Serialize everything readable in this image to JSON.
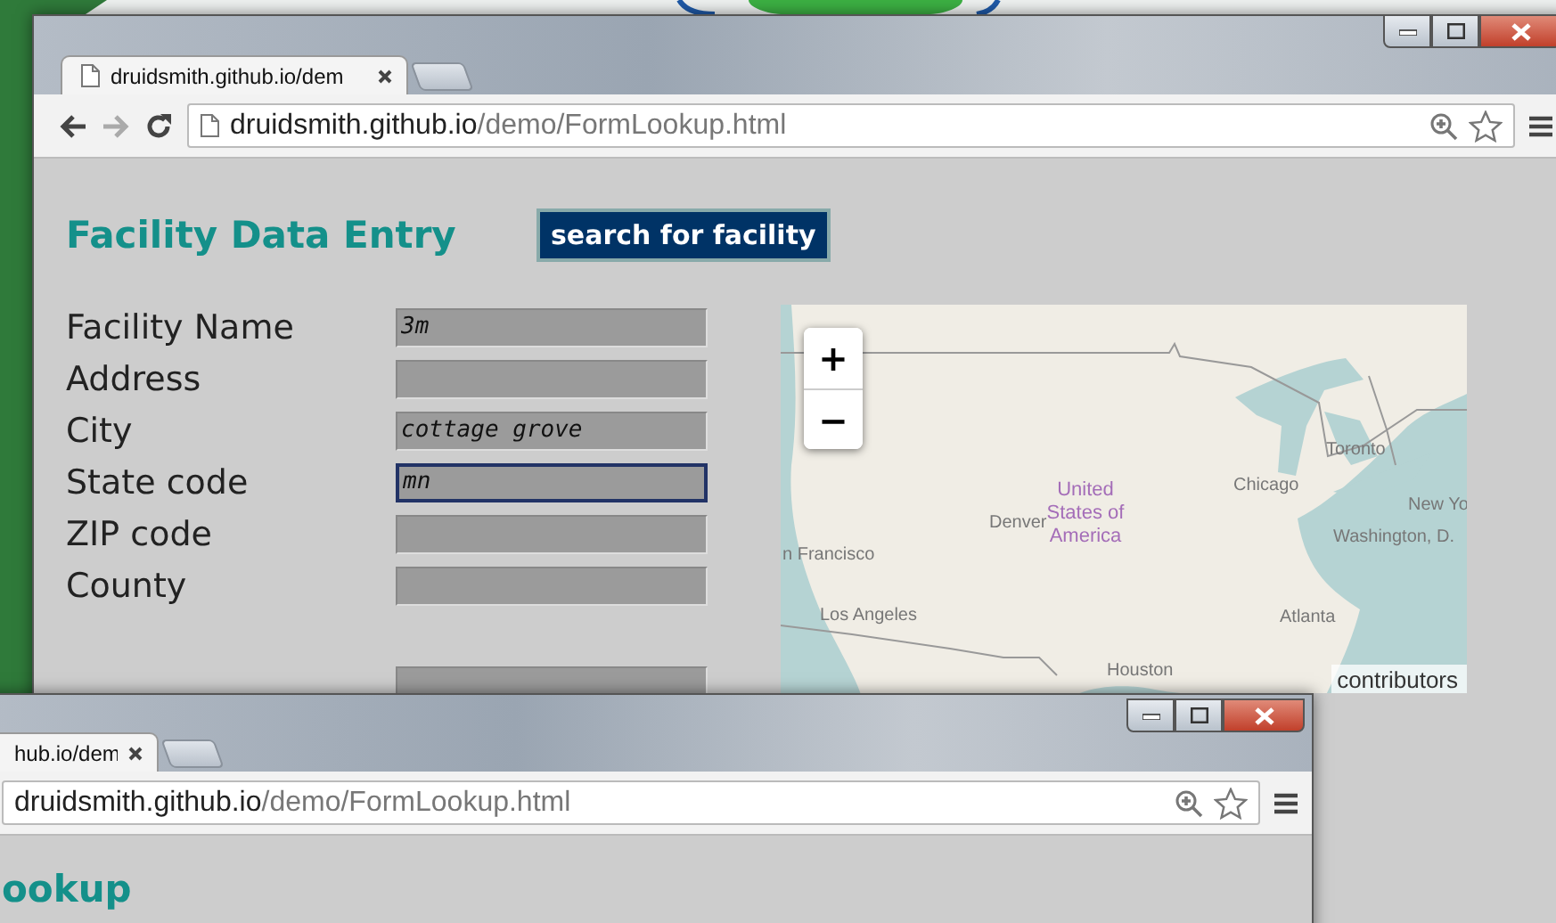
{
  "back_window": {
    "tab_title": "druidsmith.github.io/dem",
    "address": {
      "host": "druidsmith.github.io",
      "path": "/demo/FormLookup.html"
    },
    "heading": "Facility Data Entry",
    "search_button": "search for facility",
    "fields": [
      {
        "label": "Facility Name",
        "value": "3m",
        "focused": false
      },
      {
        "label": "Address",
        "focused": false
      },
      {
        "label": "City",
        "value": "cottage grove",
        "focused": false
      },
      {
        "label": "State code",
        "value": "mn",
        "focused": true
      },
      {
        "label": "ZIP code",
        "focused": false
      },
      {
        "label": "County",
        "focused": false
      }
    ],
    "coordinate_fields": [
      {
        "focused": false
      }
    ],
    "map": {
      "zoom_in": "+",
      "zoom_out": "−",
      "places": [
        {
          "name": "n Francisco",
          "kind": "city"
        },
        {
          "name": "Los Angeles",
          "kind": "city"
        },
        {
          "name": "Denver",
          "kind": "city"
        },
        {
          "name": "United States of America",
          "kind": "country"
        },
        {
          "name": "Chicago",
          "kind": "city"
        },
        {
          "name": "Toronto",
          "kind": "city"
        },
        {
          "name": "New Yo",
          "kind": "city"
        },
        {
          "name": "Washington, D.",
          "kind": "city"
        },
        {
          "name": "Atlanta",
          "kind": "city"
        },
        {
          "name": "Houston",
          "kind": "city"
        }
      ],
      "attribution": "contributors"
    }
  },
  "front_window": {
    "tab_title": "hub.io/dem",
    "address": {
      "host": "druidsmith.github.io",
      "path": "/demo/FormLookup.html"
    },
    "heading": "ookup"
  }
}
